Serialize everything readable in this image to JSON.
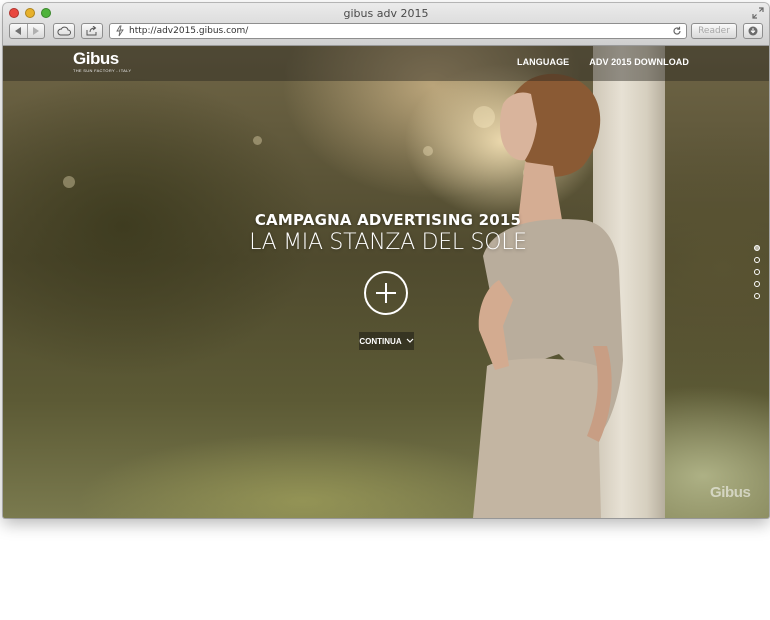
{
  "browser": {
    "window_title": "gibus adv 2015",
    "url": "http://adv2015.gibus.com/",
    "reader_label": "Reader"
  },
  "site": {
    "logo_text": "Gibus",
    "logo_tagline": "THE SUN FACTORY - ITALY",
    "menu": [
      {
        "label": "LANGUAGE"
      },
      {
        "label": "ADV 2015 DOWNLOAD"
      }
    ],
    "hero": {
      "subtitle": "CAMPAGNA ADVERTISING 2015",
      "title": "LA MIA STANZA DEL SOLE"
    },
    "continue_label": "CONTINUA",
    "watermark_logo": "Gibus",
    "slide_count": 5,
    "active_slide": 1
  },
  "icons": {
    "nav_back": "chevron-left-icon",
    "nav_forward": "chevron-right-icon",
    "cloud": "cloud-icon",
    "share": "share-icon",
    "reload": "reload-icon",
    "download": "download-icon",
    "plus": "plus-icon",
    "continue": "chevron-down-icon"
  },
  "colors": {
    "close": "#e9473f",
    "minimize": "#e7b12b",
    "zoom": "#4fb33b"
  }
}
